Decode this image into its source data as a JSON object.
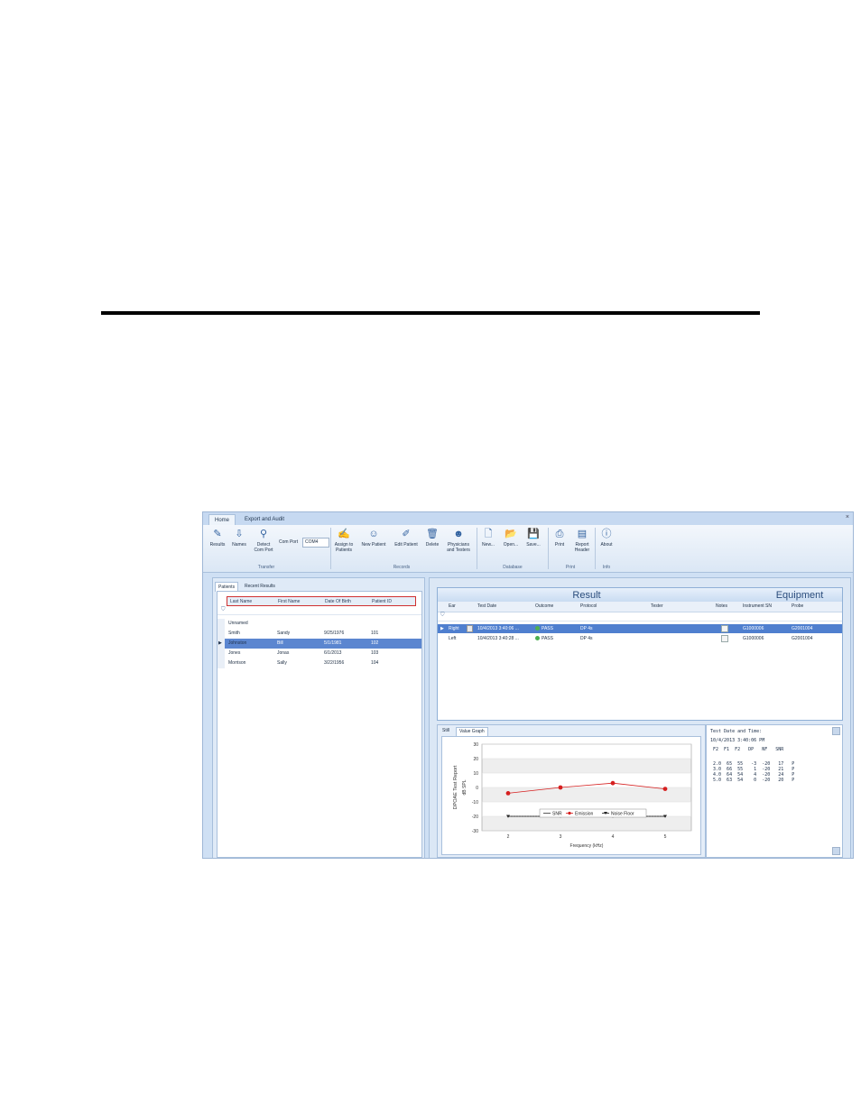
{
  "ribbon": {
    "tabs": [
      "Home",
      "Export and Audit"
    ],
    "buttons": {
      "results": "Results",
      "names": "Names",
      "detect_line1": "Detect",
      "detect_line2": "Com Port",
      "com_port_label": "Com Port",
      "com_port_value": "COM4",
      "assign_line1": "Assign to",
      "assign_line2": "Patients",
      "new_patient": "New Patient",
      "edit_patient": "Edit Patient",
      "delete": "Delete",
      "physicians_line1": "Physicians",
      "physicians_line2": "and Testers",
      "new": "New...",
      "open": "Open...",
      "save": "Save...",
      "print": "Print",
      "report_line1": "Report",
      "report_line2": "Header",
      "about": "About"
    },
    "groups": {
      "transfer": "Transfer",
      "records": "Records",
      "database": "Database",
      "print": "Print",
      "info": "Info"
    }
  },
  "patients": {
    "tabs": [
      "Patients",
      "Recent Results"
    ],
    "columns": [
      "Last Name",
      "First Name",
      "Date Of Birth",
      "Patient ID"
    ],
    "rows": [
      {
        "last": "Unnamed",
        "first": "",
        "dob": "",
        "id": ""
      },
      {
        "last": "Smith",
        "first": "Sandy",
        "dob": "9/25/1976",
        "id": "101"
      },
      {
        "last": "Johnston",
        "first": "Bill",
        "dob": "5/1/1981",
        "id": "102"
      },
      {
        "last": "Jones",
        "first": "Jonas",
        "dob": "6/1/2013",
        "id": "103"
      },
      {
        "last": "Morrison",
        "first": "Sally",
        "dob": "3/22/1956",
        "id": "104"
      }
    ],
    "selected_index": 2
  },
  "results": {
    "section_result": "Result",
    "section_equipment": "Equipment",
    "columns": [
      "Ear",
      "Test Date",
      "Outcome",
      "Protocol",
      "Tester",
      "Notes",
      "Instrument SN",
      "Probe"
    ],
    "rows": [
      {
        "ear": "Right",
        "date": "10/4/2013 3:40:06 ...",
        "outcome": "PASS",
        "protocol": "DP 4s",
        "tester": "",
        "sn": "G1000006",
        "probe": "G2001004"
      },
      {
        "ear": "Left",
        "date": "10/4/2013 3:40:28 ...",
        "outcome": "PASS",
        "protocol": "DP 4s",
        "tester": "",
        "sn": "G1000006",
        "probe": "G2001004"
      }
    ]
  },
  "graph": {
    "tabs": [
      "Still",
      "Value Graph"
    ]
  },
  "chart_data": {
    "type": "line",
    "title": "",
    "side_title": "DPOAE Test Report",
    "xlabel": "Frequency (kHz)",
    "ylabel": "dB SPL",
    "x": [
      2,
      3,
      4,
      5
    ],
    "xlim": [
      1.5,
      5.5
    ],
    "ylim": [
      -30,
      30
    ],
    "yticks": [
      30,
      20,
      10,
      0,
      -10,
      -20,
      -30
    ],
    "series": [
      {
        "name": "SNR",
        "values": [
          -20,
          -20,
          -20,
          -20
        ],
        "color": "#333333"
      },
      {
        "name": "Emission",
        "values": [
          -4,
          0,
          3,
          -1
        ],
        "color": "#d62020"
      },
      {
        "name": "Noise Floor",
        "values": [
          -20,
          -20,
          -20,
          -20
        ],
        "color": "#222222"
      }
    ],
    "legend": "bottom-inside"
  },
  "text_output": {
    "heading": "Test Date and Time:",
    "datetime": "10/4/2013 3:40:06 PM",
    "table_header": " F2  F1  F2   DP   NF   SNR",
    "table_rows": [
      " 2.0  65  55   -3  -20   17   P",
      " 3.0  66  55    1  -20   21   P",
      " 4.0  64  54    4  -20   24   P",
      " 5.0  63  54    0  -20   20   P"
    ]
  }
}
